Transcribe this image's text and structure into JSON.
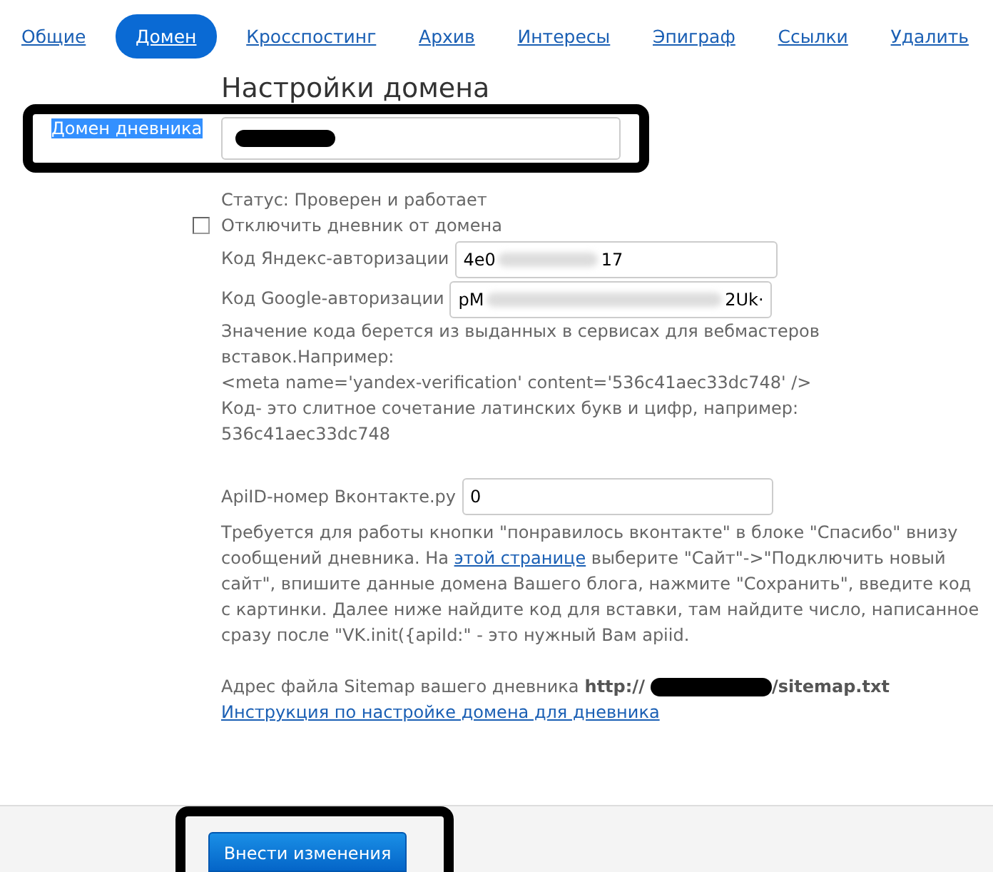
{
  "tabs": [
    {
      "label": "Общие",
      "selected": false
    },
    {
      "label": "Домен",
      "selected": true
    },
    {
      "label": "Кросспостинг",
      "selected": false
    },
    {
      "label": "Архив",
      "selected": false
    },
    {
      "label": "Интересы",
      "selected": false
    },
    {
      "label": "Эпиграф",
      "selected": false
    },
    {
      "label": "Ссылки",
      "selected": false
    },
    {
      "label": "Удалить",
      "selected": false
    }
  ],
  "title": "Настройки домена",
  "domain": {
    "label": "Домен дневника",
    "label_selected": true
  },
  "status": "Статус: Проверен и работает",
  "detach": {
    "label": "Отключить дневник от домена",
    "checked": false
  },
  "yandex": {
    "label": "Код Яндекс-авторизации",
    "value_start": "4e0",
    "value_end": "17"
  },
  "google": {
    "label": "Код Google-авторизации",
    "value_start": "pM",
    "value_end": "2Uk·"
  },
  "code_help": [
    "Значение кода берется из выданных в сервисах для вебмастеров вставок.Например:",
    "<meta name='yandex-verification' content='536c41aec33dc748' />",
    "Код- это слитное сочетание латинских букв и цифр, например: 536c41aec33dc748"
  ],
  "vk": {
    "label": "ApiID-номер Вконтакте.ру",
    "value": "0"
  },
  "vk_help": {
    "before": "Требуется для работы кнопки \"понравилось вконтакте\" в блоке \"Спасибо\" внизу сообщений дневника. На",
    "link": "этой странице",
    "after": "выберите \"Сайт\"->\"Подключить новый сайт\", впишите данные домена Вашего блога, нажмите \"Сохранить\", введите код с картинки. Далее ниже найдите код для вставки, там найдите число, написанное сразу после \"VK.init({apiId:\" - это нужный Вам apiid."
  },
  "sitemap": {
    "label": "Адрес файла Sitemap вашего дневника",
    "url_start": "http://",
    "url_end": "/sitemap.txt"
  },
  "instructions_link": "Инструкция по настройке домена для дневника",
  "submit": "Внести изменения"
}
